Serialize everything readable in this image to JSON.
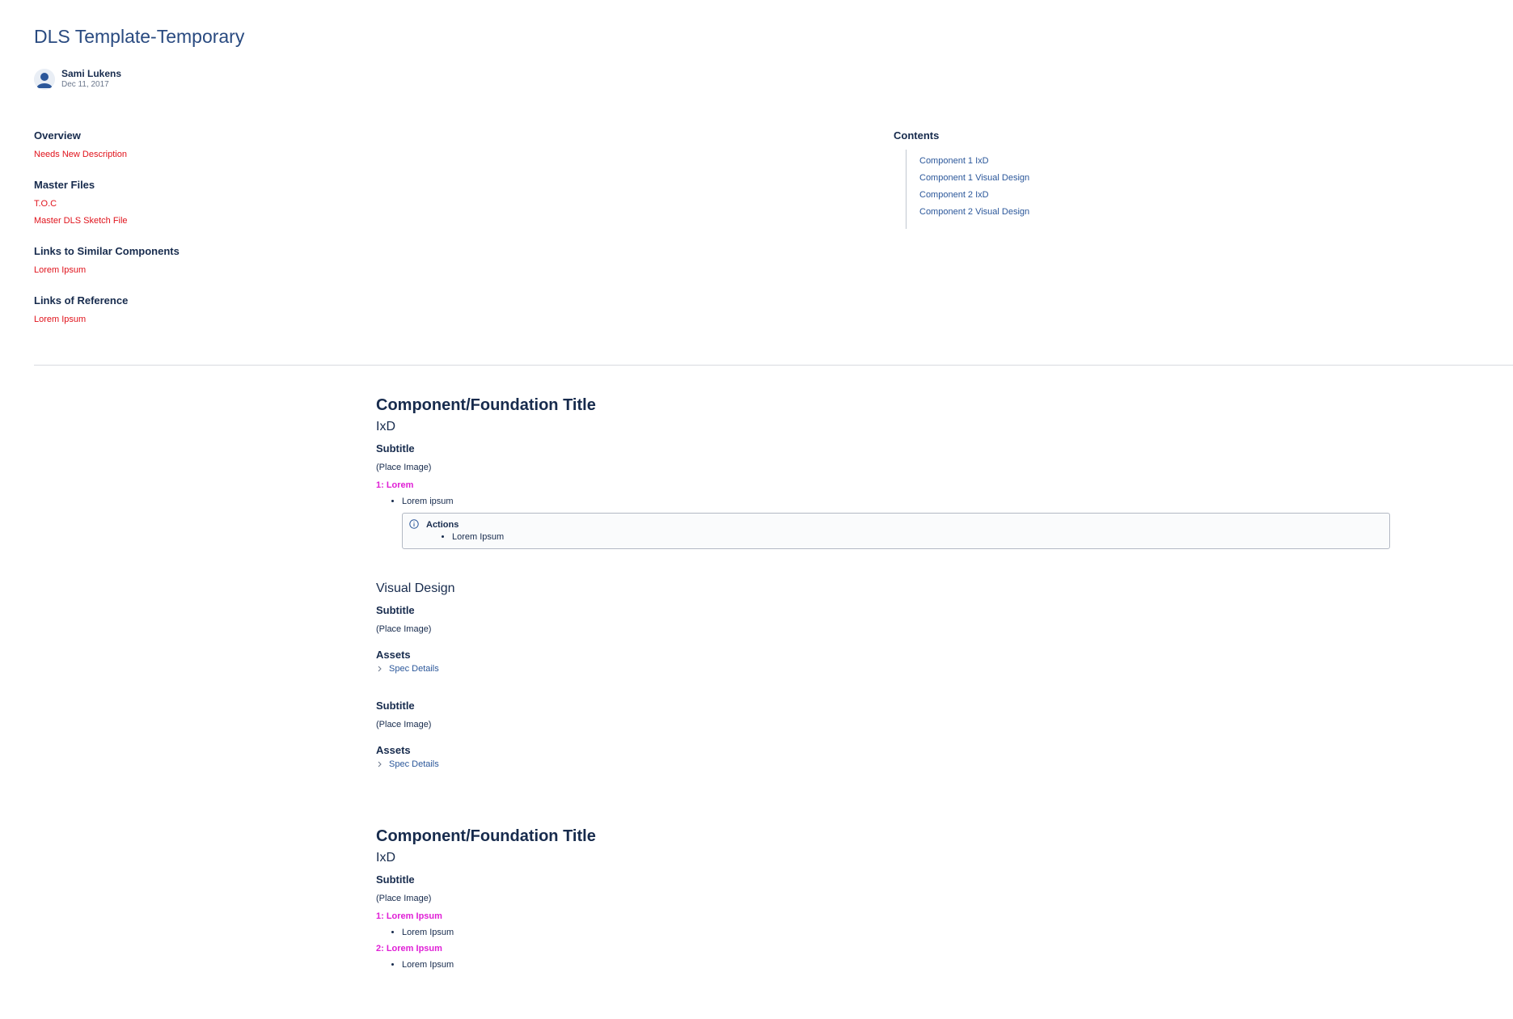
{
  "page": {
    "title": "DLS Template-Temporary",
    "author": "Sami Lukens",
    "date": "Dec 11, 2017"
  },
  "overview": {
    "overview_heading": "Overview",
    "overview_link": "Needs New Description",
    "master_heading": "Master Files",
    "master_links": [
      "T.O.C",
      "Master DLS Sketch File"
    ],
    "similar_heading": "Links to Similar Components",
    "similar_link": "Lorem Ipsum",
    "reference_heading": "Links of Reference",
    "reference_link": "Lorem Ipsum"
  },
  "contents": {
    "heading": "Contents",
    "items": [
      "Component 1 IxD",
      "Component 1 Visual Design",
      "Component 2 IxD",
      "Component 2 Visual Design"
    ]
  },
  "section1": {
    "title": "Component/Foundation Title",
    "ixd": "IxD",
    "subtitle": "Subtitle",
    "place_image": "(Place Image)",
    "numbered": "1: Lorem",
    "bullet": "Lorem ipsum",
    "panel_title": "Actions",
    "panel_item": "Lorem Ipsum",
    "visual_design": "Visual Design",
    "vd_subtitle_1": "Subtitle",
    "vd_place_image_1": "(Place Image)",
    "assets_1": "Assets",
    "spec_1": "Spec Details",
    "vd_subtitle_2": "Subtitle",
    "vd_place_image_2": "(Place Image)",
    "assets_2": "Assets",
    "spec_2": "Spec Details"
  },
  "section2": {
    "title": "Component/Foundation Title",
    "ixd": "IxD",
    "subtitle": "Subtitle",
    "place_image": "(Place Image)",
    "numbered_1": "1: Lorem Ipsum",
    "bullet_1": "Lorem Ipsum",
    "numbered_2": "2: Lorem Ipsum",
    "bullet_2": "Lorem Ipsum"
  },
  "colors": {
    "title": "#294a80",
    "red_link": "#e0121b",
    "blue_link": "#2b579a",
    "magenta": "#e01fd6"
  }
}
